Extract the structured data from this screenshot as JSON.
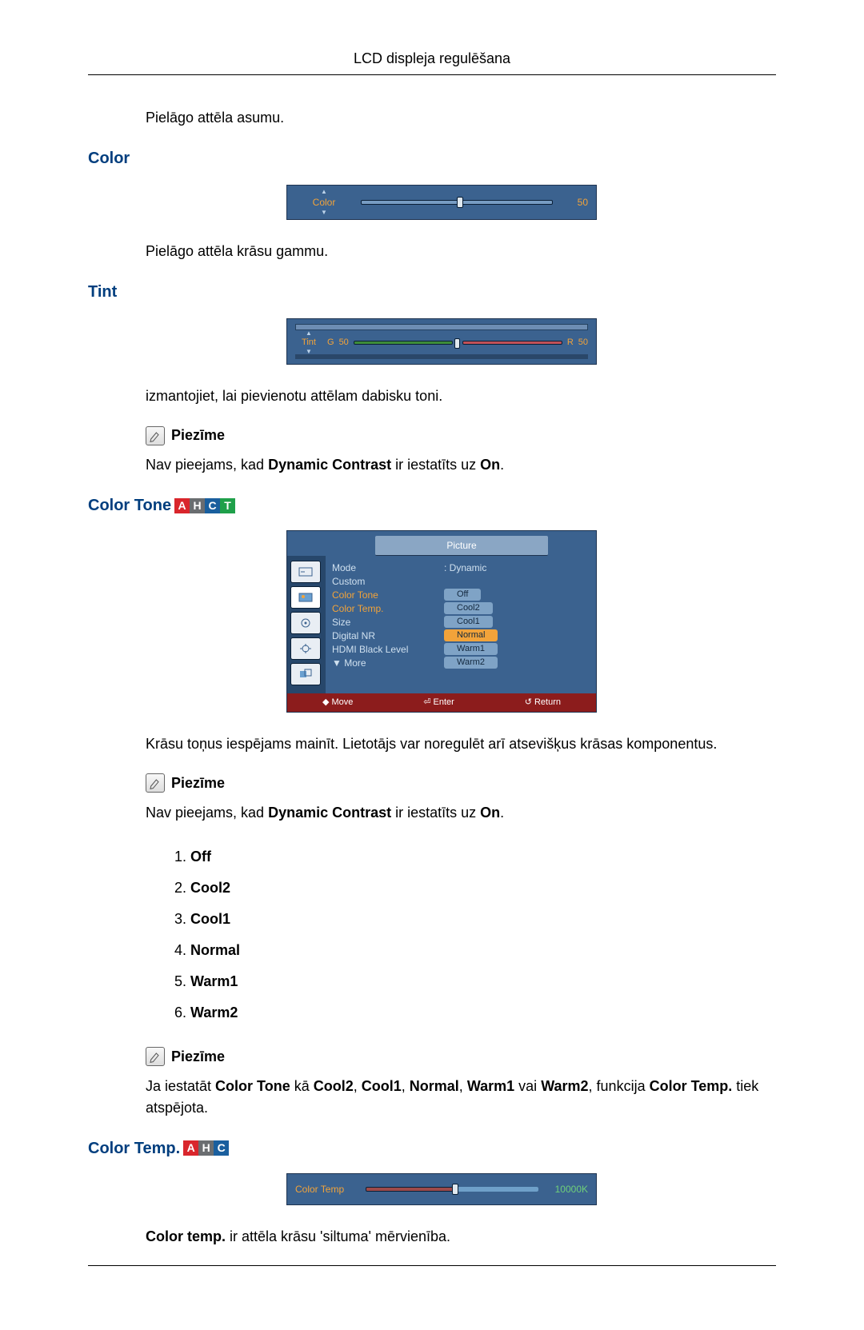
{
  "header_title": "LCD displeja regulēšana",
  "intro_para": "Pielāgo attēla asumu.",
  "color_heading": "Color",
  "color_osd": {
    "label": "Color",
    "value": "50",
    "pos_pct": 50
  },
  "color_desc": "Pielāgo attēla krāsu gammu.",
  "tint_heading": "Tint",
  "tint_osd": {
    "label": "Tint",
    "g_label": "G",
    "g_value": "50",
    "r_label": "R",
    "r_value": "50",
    "pos_pct": 50
  },
  "tint_desc": "izmantojiet, lai pievienotu attēlam dabisku toni.",
  "note_label": "Piezīme",
  "tint_note": {
    "pre": "Nav pieejams, kad ",
    "b1": "Dynamic Contrast",
    "mid": " ir iestatīts uz ",
    "b2": "On",
    "post": "."
  },
  "colortone_heading": "Color Tone",
  "colortone_tags": [
    "A",
    "H",
    "C",
    "T"
  ],
  "picture_menu": {
    "title": "Picture",
    "rows": [
      {
        "label": "Mode",
        "value": ": Dynamic",
        "hl": false
      },
      {
        "label": "Custom",
        "value": "",
        "hl": false
      },
      {
        "label": "Color Tone",
        "value": "Off",
        "hl": true,
        "chip": true,
        "sel": false
      },
      {
        "label": "Color Temp.",
        "value": "Cool2",
        "hl": true,
        "chip": true,
        "sel": false
      },
      {
        "label": "Size",
        "value": "Cool1",
        "chip": true,
        "sel": false
      },
      {
        "label": "Digital NR",
        "value": "Normal",
        "chip": true,
        "sel": true
      },
      {
        "label": "HDMI Black Level",
        "value": "Warm1",
        "chip": true,
        "sel": false
      },
      {
        "label": "▼  More",
        "value": "Warm2",
        "chip": true,
        "sel": false
      }
    ],
    "footer": [
      "◆ Move",
      "⏎ Enter",
      "↺ Return"
    ]
  },
  "colortone_desc": "Krāsu toņus iespējams mainīt. Lietotājs var noregulēt arī atsevišķus krāsas komponentus.",
  "colortone_note": {
    "pre": "Nav pieejams, kad ",
    "b1": "Dynamic Contrast",
    "mid": " ir iestatīts uz ",
    "b2": "On",
    "post": "."
  },
  "options": [
    "Off",
    "Cool2",
    "Cool1",
    "Normal",
    "Warm1",
    "Warm2"
  ],
  "colortone_note2": {
    "pre": "Ja iestatāt ",
    "b1": "Color Tone",
    "mid1": " kā ",
    "b2": "Cool2",
    "c2": ", ",
    "b3": "Cool1",
    "c3": ", ",
    "b4": "Normal",
    "c4": ", ",
    "b5": "Warm1",
    "mid2": " vai ",
    "b6": "Warm2",
    "mid3": ", funkcija ",
    "b7": "Color Temp.",
    "post": " tiek atspējota."
  },
  "colortemp_heading": "Color Temp.",
  "colortemp_tags": [
    "A",
    "H",
    "C"
  ],
  "colortemp_osd": {
    "label": "Color Temp",
    "value": "10000K",
    "pos_pct": 50
  },
  "colortemp_desc": {
    "b": "Color temp.",
    "rest": " ir attēla krāsu 'siltuma' mērvienība."
  }
}
